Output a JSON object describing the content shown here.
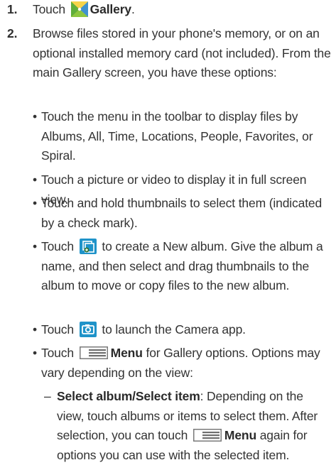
{
  "steps": [
    {
      "number": "1.",
      "pre": "Touch",
      "icon": "gallery-icon",
      "label": "Gallery",
      "post": "."
    },
    {
      "number": "2.",
      "text": "Browse files stored in your phone's memory, or on an optional installed memory card (not included). From the main Gallery screen, you have these options:"
    }
  ],
  "bullets": [
    {
      "dot": "•",
      "text": "Touch the menu in the toolbar to display files by Albums, All, Time, Locations, People, Favorites, or Spiral."
    },
    {
      "dot": "•",
      "text": "Touch a picture or video to display it in full screen view."
    },
    {
      "dot": "•",
      "text": "Touch and hold thumbnails to select them (indicated by a check mark)."
    },
    {
      "dot": "•",
      "pre": "Touch",
      "icon": "new-album-icon",
      "text": "to create a New album. Give the album a name, and then select and drag thumbnails to the album to move or copy files to the new album."
    },
    {
      "dot": "•",
      "pre": "Touch",
      "icon": "camera-icon",
      "text": "to launch the Camera app."
    },
    {
      "dot": "•",
      "pre": "Touch",
      "icon": "menu-icon",
      "bold": "Menu",
      "text": "for Gallery options. Options may vary depending on the view:"
    }
  ],
  "subitems": [
    {
      "dash": "–",
      "bold": "Select album/Select item",
      "text1": ": Depending on the view, touch albums or items to select them. After selection, you can touch",
      "icon": "menu-icon",
      "bold2": "Menu",
      "text2": "again for options you can use with the selected item."
    }
  ],
  "colors": {
    "text": "#333333",
    "icon_blue": "#1a8fc4",
    "gallery_yellow": "#f5c518",
    "gallery_green": "#6bbf3a",
    "menu_gray": "#7a7a7a"
  }
}
